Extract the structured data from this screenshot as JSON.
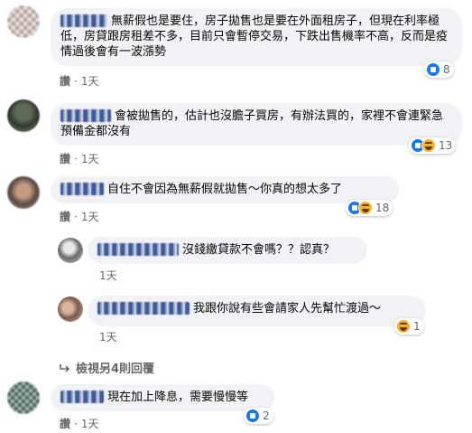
{
  "comments": [
    {
      "text": "無薪假也是要住，房子拋售也是要在外面租房子，但現在利率極低，房貸跟房租差不多，目前只會暫停交易，下跌出售機率不高，反而是疫情過後會有一波漲勢",
      "like_label": "讚",
      "time": "1天",
      "reaction_count": "8"
    },
    {
      "text": "會被拋售的，估計也沒膽子買房，有辦法買的，家裡不會連緊急預備金都沒有",
      "like_label": "讚",
      "time": "1天",
      "reaction_count": "13"
    },
    {
      "text": "自住不會因為無薪假就拋售～你真的想太多了",
      "like_label": "讚",
      "time": "1天",
      "reaction_count": "18"
    },
    {
      "text": "沒錢繳貸款不會嗎？？認真？",
      "time": "1天"
    },
    {
      "text": "我跟你說有些會請家人先幫忙渡過～",
      "time": "1天",
      "reaction_count": "1"
    },
    {
      "text": "現在加上降息，需要慢慢等",
      "like_label": "讚",
      "time": "1天",
      "reaction_count": "2"
    }
  ],
  "view_more": "檢視另4則回覆",
  "separator": "·",
  "colors": {
    "bubble": "#f0f2f5",
    "meta": "#65676b",
    "like_blue": "#1877f2",
    "haha_yellow": "#f7b125"
  },
  "icons": {
    "like": "like-reaction-icon",
    "haha": "haha-reaction-icon",
    "reply_arrow": "reply-arrow-icon"
  }
}
